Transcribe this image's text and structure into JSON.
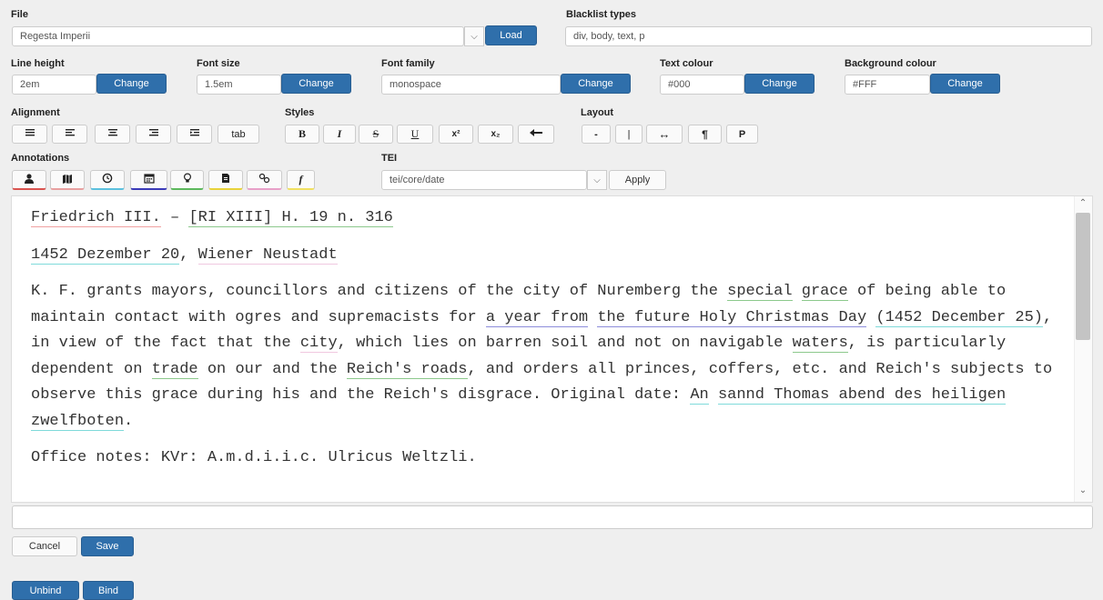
{
  "file": {
    "label": "File",
    "value": "Regesta Imperii",
    "load_label": "Load"
  },
  "blacklist": {
    "label": "Blacklist types",
    "value": "div, body, text, p"
  },
  "settings": {
    "line_height": {
      "label": "Line height",
      "value": "2em",
      "button": "Change"
    },
    "font_size": {
      "label": "Font size",
      "value": "1.5em",
      "button": "Change"
    },
    "font_family": {
      "label": "Font family",
      "value": "monospace",
      "button": "Change"
    },
    "text_colour": {
      "label": "Text colour",
      "value": "#000",
      "button": "Change"
    },
    "background_colour": {
      "label": "Background colour",
      "value": "#FFF",
      "button": "Change"
    }
  },
  "alignment": {
    "label": "Alignment",
    "tab_label": "tab"
  },
  "styles": {
    "label": "Styles",
    "bold": "B",
    "italic": "I",
    "strike": "S",
    "underline": "U",
    "superscript": "x²",
    "subscript": "x₂"
  },
  "layout": {
    "label": "Layout",
    "dash": "-",
    "bar": "|",
    "arrows": "↔",
    "pilcrow": "¶",
    "p": "P"
  },
  "annotations": {
    "label": "Annotations",
    "buttons": [
      {
        "icon": "person-icon",
        "color": "#d9534f"
      },
      {
        "icon": "map-icon",
        "color": "#e8a0a0"
      },
      {
        "icon": "clock-icon",
        "color": "#5bc0de"
      },
      {
        "icon": "calendar-icon",
        "color": "#3b3bb8"
      },
      {
        "icon": "lightbulb-icon",
        "color": "#5cb85c"
      },
      {
        "icon": "file-icon",
        "color": "#e8d23a"
      },
      {
        "icon": "link-icon",
        "color": "#e8a0c8"
      },
      {
        "icon": "function-icon",
        "color": "#f0e060"
      }
    ]
  },
  "tei": {
    "label": "TEI",
    "value": "tei/core/date",
    "apply_label": "Apply"
  },
  "editor": {
    "title_1": "Friedrich III.",
    "title_sep": " – ",
    "title_2": "[RI XIII] H. 19 n. 316",
    "date_1": "1452 Dezember 20",
    "date_sep": ", ",
    "date_2": "Wiener Neustadt",
    "body": {
      "s1": "K. F. grants mayors, councillors and citizens of the city of Nuremberg the ",
      "special": "special",
      "grace": "grace",
      "s2": " of being able to maintain contact with ogres and supremacists for ",
      "a_year_from": "a year from",
      "the_future": "the future Holy Christmas Day",
      "s3": " ",
      "date_paren": "(1452 December 25)",
      "s4": ", in view of the fact that the ",
      "city": "city",
      "s5": ", which lies on barren soil and not on navigable ",
      "waters": "waters",
      "s6": ", is particularly dependent on ",
      "trade": "trade",
      "s7": " on our and the ",
      "reichs_roads": "Reich's roads",
      "s8": ", and orders all princes, coffers, etc. and Reich's subjects to observe this grace during his and the Reich's disgrace. Original date: ",
      "an": "An",
      "sannd": "sannd Thomas abend des heiligen zwelfboten",
      "s9": "."
    },
    "office_notes": "Office notes: KVr: A.m.d.i.i.c. Ulricus Weltzli."
  },
  "footer": {
    "input_value": "",
    "cancel_label": "Cancel",
    "save_label": "Save",
    "unbind_label": "Unbind",
    "bind_label": "Bind"
  }
}
